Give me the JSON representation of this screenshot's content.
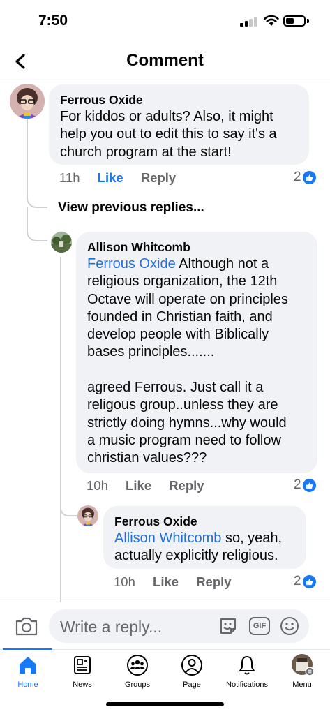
{
  "status_bar": {
    "time": "7:50"
  },
  "header": {
    "title": "Comment",
    "back_icon": "chevron-left-icon"
  },
  "comments": [
    {
      "author": "Ferrous Oxide",
      "text_lines": [
        "For kiddos or adults?  Also, it might",
        "help you out to edit this to say it's a",
        "church program at the start!"
      ],
      "time": "11h",
      "like_label": "Like",
      "reply_label": "Reply",
      "reaction_count": "2"
    },
    {
      "author": "Allison Whitcomb",
      "mention": "Ferrous Oxide",
      "text_first_line": " Although not a",
      "text_lines": [
        "religious organization, the 12th",
        "Octave will operate on principles",
        "founded in Christian faith, and",
        "develop people with Biblically",
        "bases principles.......",
        "",
        "agreed Ferrous. Just call it a",
        "religous group..unless they are",
        "strictly doing hymns...why would",
        "a music program need to follow",
        "christian values???"
      ],
      "time": "10h",
      "like_label": "Like",
      "reply_label": "Reply",
      "reaction_count": "2"
    },
    {
      "author": "Ferrous Oxide",
      "mention": "Allison Whitcomb",
      "text_first_line": " so, yeah,",
      "text_lines": [
        "actually explicitly religious."
      ],
      "time": "10h",
      "like_label": "Like",
      "reply_label": "Reply",
      "reaction_count": "2"
    }
  ],
  "view_previous_replies": "View previous replies...",
  "composer": {
    "placeholder": "Write a reply...",
    "gif_label": "GIF"
  },
  "tabs": [
    {
      "label": "Home",
      "icon": "home-icon",
      "active": true
    },
    {
      "label": "News",
      "icon": "news-icon",
      "active": false
    },
    {
      "label": "Groups",
      "icon": "groups-icon",
      "active": false
    },
    {
      "label": "Page",
      "icon": "page-icon",
      "active": false
    },
    {
      "label": "Notifications",
      "icon": "bell-icon",
      "active": false
    },
    {
      "label": "Menu",
      "icon": "menu-avatar-icon",
      "active": false
    }
  ],
  "colors": {
    "accent": "#1877f2",
    "mention": "#216fdb",
    "bubble": "#f0f2f5",
    "muted": "#65676b"
  }
}
